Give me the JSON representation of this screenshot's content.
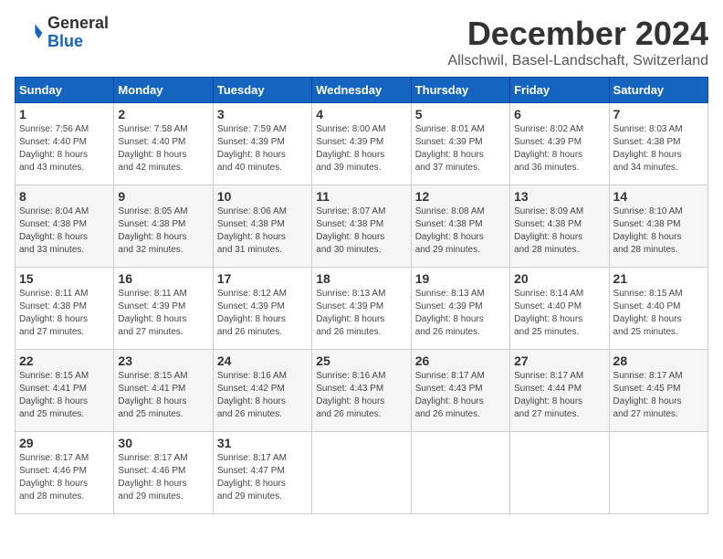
{
  "logo": {
    "general": "General",
    "blue": "Blue"
  },
  "title": "December 2024",
  "subtitle": "Allschwil, Basel-Landschaft, Switzerland",
  "days_of_week": [
    "Sunday",
    "Monday",
    "Tuesday",
    "Wednesday",
    "Thursday",
    "Friday",
    "Saturday"
  ],
  "weeks": [
    [
      {
        "day": "1",
        "sunrise": "7:56 AM",
        "sunset": "4:40 PM",
        "daylight": "8 hours and 43 minutes."
      },
      {
        "day": "2",
        "sunrise": "7:58 AM",
        "sunset": "4:40 PM",
        "daylight": "8 hours and 42 minutes."
      },
      {
        "day": "3",
        "sunrise": "7:59 AM",
        "sunset": "4:39 PM",
        "daylight": "8 hours and 40 minutes."
      },
      {
        "day": "4",
        "sunrise": "8:00 AM",
        "sunset": "4:39 PM",
        "daylight": "8 hours and 39 minutes."
      },
      {
        "day": "5",
        "sunrise": "8:01 AM",
        "sunset": "4:39 PM",
        "daylight": "8 hours and 37 minutes."
      },
      {
        "day": "6",
        "sunrise": "8:02 AM",
        "sunset": "4:39 PM",
        "daylight": "8 hours and 36 minutes."
      },
      {
        "day": "7",
        "sunrise": "8:03 AM",
        "sunset": "4:38 PM",
        "daylight": "8 hours and 34 minutes."
      }
    ],
    [
      {
        "day": "8",
        "sunrise": "8:04 AM",
        "sunset": "4:38 PM",
        "daylight": "8 hours and 33 minutes."
      },
      {
        "day": "9",
        "sunrise": "8:05 AM",
        "sunset": "4:38 PM",
        "daylight": "8 hours and 32 minutes."
      },
      {
        "day": "10",
        "sunrise": "8:06 AM",
        "sunset": "4:38 PM",
        "daylight": "8 hours and 31 minutes."
      },
      {
        "day": "11",
        "sunrise": "8:07 AM",
        "sunset": "4:38 PM",
        "daylight": "8 hours and 30 minutes."
      },
      {
        "day": "12",
        "sunrise": "8:08 AM",
        "sunset": "4:38 PM",
        "daylight": "8 hours and 29 minutes."
      },
      {
        "day": "13",
        "sunrise": "8:09 AM",
        "sunset": "4:38 PM",
        "daylight": "8 hours and 28 minutes."
      },
      {
        "day": "14",
        "sunrise": "8:10 AM",
        "sunset": "4:38 PM",
        "daylight": "8 hours and 28 minutes."
      }
    ],
    [
      {
        "day": "15",
        "sunrise": "8:11 AM",
        "sunset": "4:38 PM",
        "daylight": "8 hours and 27 minutes."
      },
      {
        "day": "16",
        "sunrise": "8:11 AM",
        "sunset": "4:39 PM",
        "daylight": "8 hours and 27 minutes."
      },
      {
        "day": "17",
        "sunrise": "8:12 AM",
        "sunset": "4:39 PM",
        "daylight": "8 hours and 26 minutes."
      },
      {
        "day": "18",
        "sunrise": "8:13 AM",
        "sunset": "4:39 PM",
        "daylight": "8 hours and 26 minutes."
      },
      {
        "day": "19",
        "sunrise": "8:13 AM",
        "sunset": "4:39 PM",
        "daylight": "8 hours and 26 minutes."
      },
      {
        "day": "20",
        "sunrise": "8:14 AM",
        "sunset": "4:40 PM",
        "daylight": "8 hours and 25 minutes."
      },
      {
        "day": "21",
        "sunrise": "8:15 AM",
        "sunset": "4:40 PM",
        "daylight": "8 hours and 25 minutes."
      }
    ],
    [
      {
        "day": "22",
        "sunrise": "8:15 AM",
        "sunset": "4:41 PM",
        "daylight": "8 hours and 25 minutes."
      },
      {
        "day": "23",
        "sunrise": "8:15 AM",
        "sunset": "4:41 PM",
        "daylight": "8 hours and 25 minutes."
      },
      {
        "day": "24",
        "sunrise": "8:16 AM",
        "sunset": "4:42 PM",
        "daylight": "8 hours and 26 minutes."
      },
      {
        "day": "25",
        "sunrise": "8:16 AM",
        "sunset": "4:43 PM",
        "daylight": "8 hours and 26 minutes."
      },
      {
        "day": "26",
        "sunrise": "8:17 AM",
        "sunset": "4:43 PM",
        "daylight": "8 hours and 26 minutes."
      },
      {
        "day": "27",
        "sunrise": "8:17 AM",
        "sunset": "4:44 PM",
        "daylight": "8 hours and 27 minutes."
      },
      {
        "day": "28",
        "sunrise": "8:17 AM",
        "sunset": "4:45 PM",
        "daylight": "8 hours and 27 minutes."
      }
    ],
    [
      {
        "day": "29",
        "sunrise": "8:17 AM",
        "sunset": "4:46 PM",
        "daylight": "8 hours and 28 minutes."
      },
      {
        "day": "30",
        "sunrise": "8:17 AM",
        "sunset": "4:46 PM",
        "daylight": "8 hours and 29 minutes."
      },
      {
        "day": "31",
        "sunrise": "8:17 AM",
        "sunset": "4:47 PM",
        "daylight": "8 hours and 29 minutes."
      },
      null,
      null,
      null,
      null
    ]
  ]
}
